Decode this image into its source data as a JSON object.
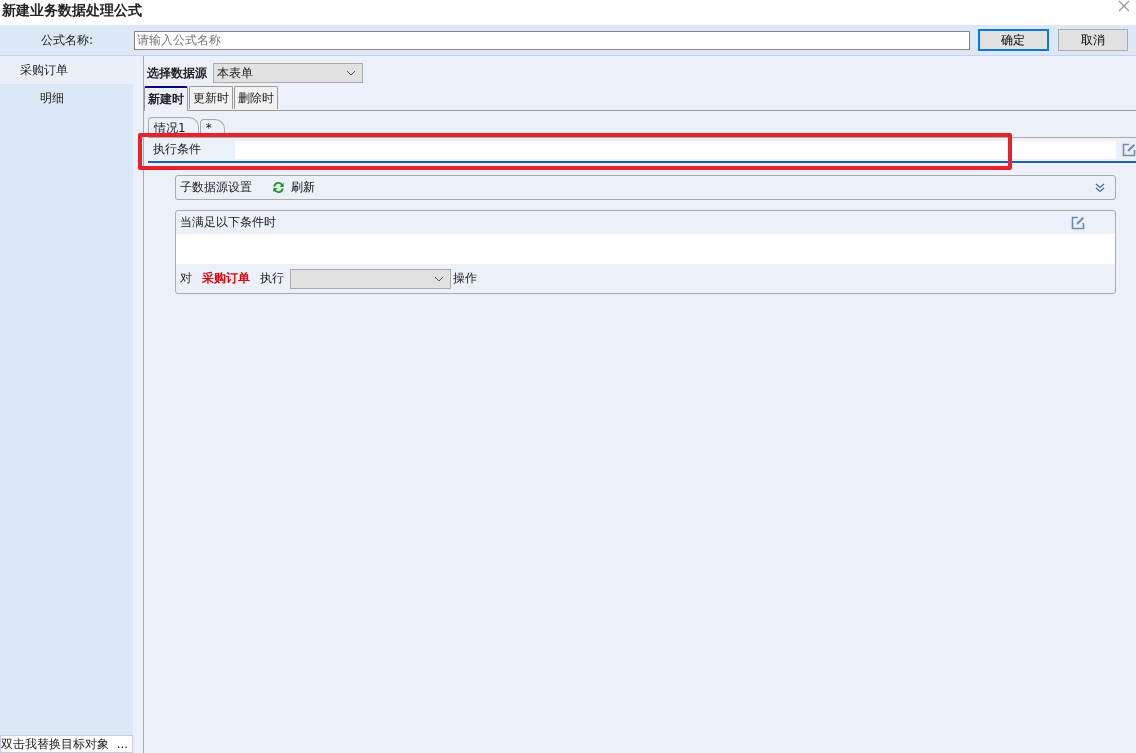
{
  "window": {
    "title": "新建业务数据处理公式"
  },
  "name_row": {
    "label": "公式名称:",
    "placeholder": "请输入公式名称",
    "buttons": [
      {
        "label": "确定",
        "kind": "primary"
      },
      {
        "label": "取消",
        "kind": "normal"
      }
    ]
  },
  "sidebar": {
    "items": [
      {
        "label": "采购订单",
        "selected": true
      },
      {
        "label": "明细",
        "selected": false
      }
    ],
    "footer": "双击我替换目标对象",
    "footer_button": "..."
  },
  "datasource": {
    "label": "选择数据源",
    "value": "本表单"
  },
  "tabs": [
    {
      "label": "新建时",
      "selected": true
    },
    {
      "label": "更新时",
      "selected": false
    },
    {
      "label": "删除时",
      "selected": false
    }
  ],
  "case_tabs": [
    {
      "label": "情况1",
      "selected": true
    },
    {
      "label": "*",
      "selected": false
    }
  ],
  "condition": {
    "label": "执行条件"
  },
  "sub_source": {
    "label": "子数据源设置",
    "refresh": "刷新"
  },
  "rule": {
    "title": "当满足以下条件时",
    "prefix": "对",
    "target": "采购订单",
    "verb": "执行",
    "suffix": "操作"
  }
}
